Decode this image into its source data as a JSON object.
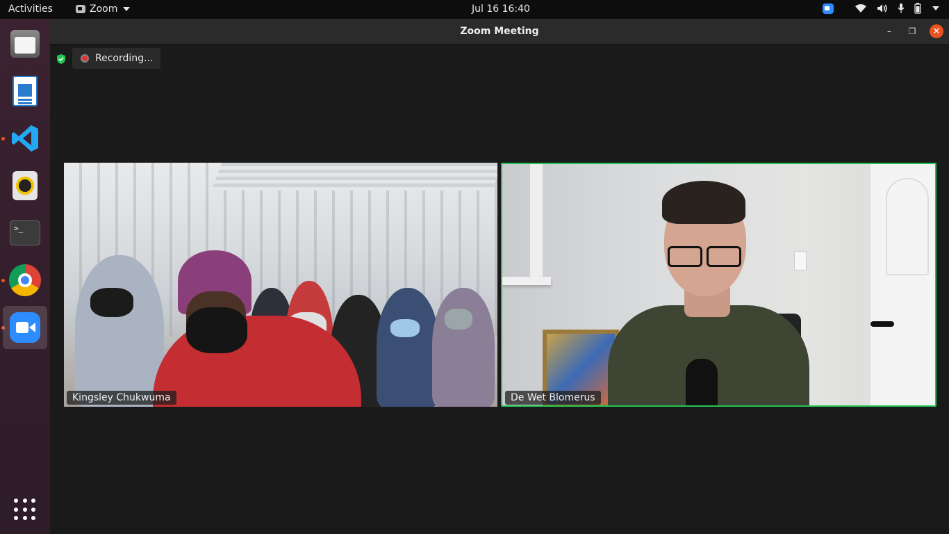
{
  "topbar": {
    "activities": "Activities",
    "app_name": "Zoom",
    "clock": "Jul 16  16:40"
  },
  "dock": {
    "items": [
      {
        "name": "Files",
        "icon": "files-icon"
      },
      {
        "name": "LibreOffice Writer",
        "icon": "writer-icon"
      },
      {
        "name": "Visual Studio Code",
        "icon": "vscode-icon"
      },
      {
        "name": "Rhythmbox",
        "icon": "rhythmbox-icon"
      },
      {
        "name": "Terminal",
        "icon": "terminal-icon"
      },
      {
        "name": "Google Chrome",
        "icon": "chrome-icon"
      },
      {
        "name": "Zoom",
        "icon": "zoom-icon"
      }
    ],
    "show_apps_icon": "app-grid-icon",
    "terminal_glyph": ">_"
  },
  "window": {
    "title": "Zoom Meeting",
    "recording_label": "Recording...",
    "close_glyph": "✕",
    "minimize_glyph": "–",
    "restore_glyph": "❐"
  },
  "participants": [
    {
      "name": "Kingsley Chukwuma",
      "active_speaker": false
    },
    {
      "name": "De Wet Blomerus",
      "active_speaker": true
    }
  ],
  "colors": {
    "active_speaker_border": "#23c552",
    "close_button": "#e95420",
    "zoom_blue": "#2d8cff",
    "running_indicator": "#e95420"
  }
}
